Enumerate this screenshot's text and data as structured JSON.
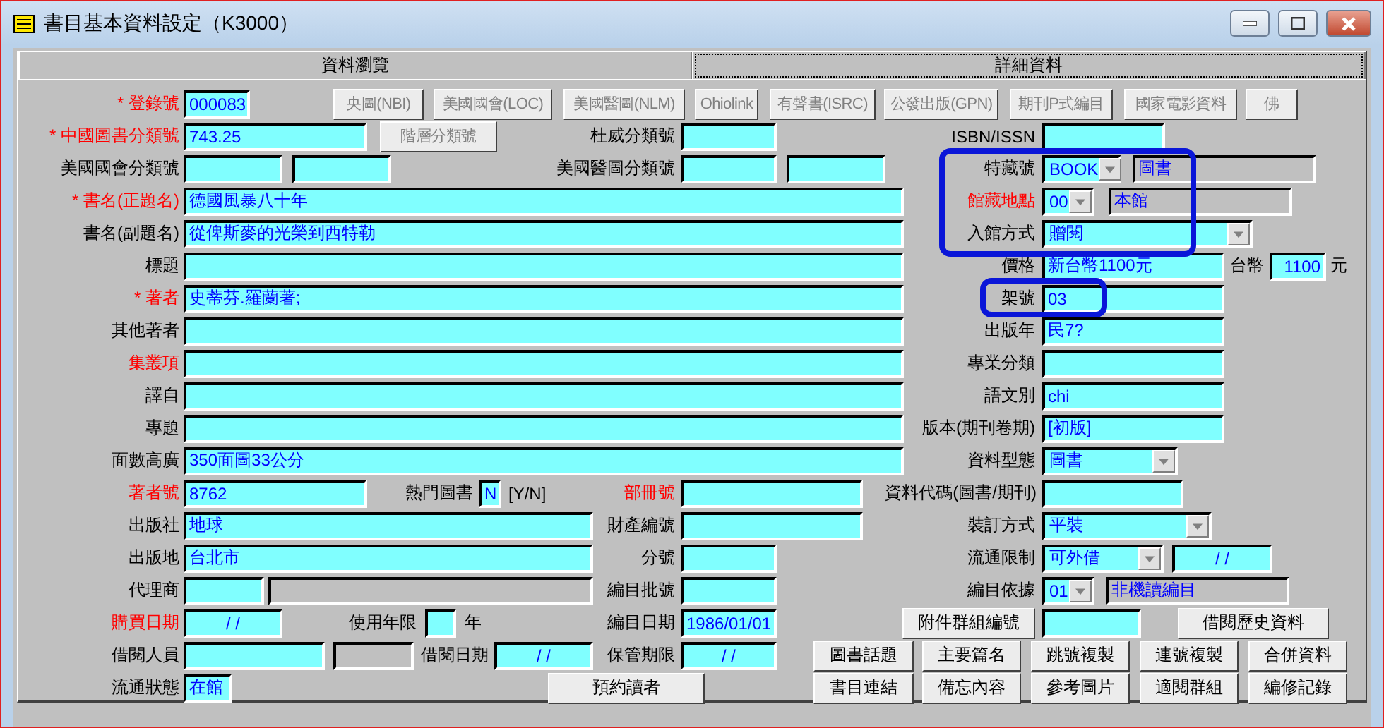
{
  "window": {
    "title": "書目基本資料設定（K3000）"
  },
  "tabs": [
    {
      "label": "資料瀏覽",
      "selected": false
    },
    {
      "label": "詳細資料",
      "selected": true
    }
  ],
  "rows": [
    {
      "items": [
        {
          "kind": "label",
          "text": "* 登錄號",
          "required": true
        },
        {
          "kind": "field",
          "value": "000083"
        },
        {
          "kind": "button",
          "text": "央圖(NBI)",
          "disabled": true
        },
        {
          "kind": "button",
          "text": "美國國會(LOC)",
          "disabled": true
        },
        {
          "kind": "button",
          "text": "美國醫圖(NLM)",
          "disabled": true
        },
        {
          "kind": "button",
          "text": "Ohiolink",
          "disabled": true
        },
        {
          "kind": "button",
          "text": "有聲書(ISRC)",
          "disabled": true
        },
        {
          "kind": "button",
          "text": "公發出版(GPN)",
          "disabled": true
        },
        {
          "kind": "button",
          "text": "期刊P式編目",
          "disabled": true
        },
        {
          "kind": "button",
          "text": "國家電影資料",
          "disabled": true
        },
        {
          "kind": "button",
          "text": "佛",
          "disabled": true
        }
      ]
    },
    {
      "items": [
        {
          "kind": "label",
          "text": "* 中國圖書分類號",
          "required": true
        },
        {
          "kind": "field",
          "value": "743.25"
        },
        {
          "kind": "button",
          "text": "階層分類號",
          "disabled": true
        },
        {
          "kind": "label",
          "text": "杜威分類號",
          "required": false
        },
        {
          "kind": "field"
        },
        {
          "kind": "label",
          "text": "ISBN/ISSN",
          "required": false
        },
        {
          "kind": "field"
        }
      ]
    },
    {
      "items": [
        {
          "kind": "label",
          "text": "美國國會分類號",
          "required": false
        },
        {
          "kind": "field"
        },
        {
          "kind": "field"
        },
        {
          "kind": "label",
          "text": "美國醫圖分類號",
          "required": false
        },
        {
          "kind": "field"
        },
        {
          "kind": "field"
        },
        {
          "kind": "label",
          "text": "特藏號",
          "required": false
        },
        {
          "kind": "select",
          "value": "BOOK"
        },
        {
          "kind": "readonly",
          "value": "圖書"
        }
      ]
    },
    {
      "items": [
        {
          "kind": "label",
          "text": "* 書名(正題名)",
          "required": true
        },
        {
          "kind": "field",
          "value": "德國風暴八十年"
        },
        {
          "kind": "label",
          "text": "館藏地點",
          "required": true
        },
        {
          "kind": "select",
          "value": "00"
        },
        {
          "kind": "readonly",
          "value": "本館"
        }
      ]
    },
    {
      "items": [
        {
          "kind": "label",
          "text": "書名(副題名)",
          "required": false
        },
        {
          "kind": "field",
          "value": "從俾斯麥的光榮到西特勒"
        },
        {
          "kind": "label",
          "text": "入館方式",
          "required": false
        },
        {
          "kind": "select",
          "value": "贈閱"
        }
      ]
    },
    {
      "items": [
        {
          "kind": "label",
          "text": "標題",
          "required": false
        },
        {
          "kind": "field"
        },
        {
          "kind": "label",
          "text": "價格",
          "required": false
        },
        {
          "kind": "field",
          "value": "新台幣1100元"
        },
        {
          "kind": "note",
          "text": "台幣"
        },
        {
          "kind": "number",
          "value": "1100"
        },
        {
          "kind": "note",
          "text": "元"
        }
      ]
    },
    {
      "items": [
        {
          "kind": "label",
          "text": "* 著者",
          "required": true
        },
        {
          "kind": "field",
          "value": "史蒂芬.羅蘭著;"
        },
        {
          "kind": "label",
          "text": "架號",
          "required": false
        },
        {
          "kind": "field",
          "value": "03"
        }
      ]
    },
    {
      "items": [
        {
          "kind": "label",
          "text": "其他著者",
          "required": false
        },
        {
          "kind": "field"
        },
        {
          "kind": "label",
          "text": "出版年",
          "required": false
        },
        {
          "kind": "field",
          "value": "民7?"
        }
      ]
    },
    {
      "items": [
        {
          "kind": "label",
          "text": "集叢項",
          "required": true
        },
        {
          "kind": "field"
        },
        {
          "kind": "label",
          "text": "專業分類",
          "required": false
        },
        {
          "kind": "field"
        }
      ]
    },
    {
      "items": [
        {
          "kind": "label",
          "text": "譯自",
          "required": false
        },
        {
          "kind": "field"
        },
        {
          "kind": "label",
          "text": "語文別",
          "required": false
        },
        {
          "kind": "field",
          "value": "chi"
        }
      ]
    },
    {
      "items": [
        {
          "kind": "label",
          "text": "專題",
          "required": false
        },
        {
          "kind": "field"
        },
        {
          "kind": "label",
          "text": "版本(期刊卷期)",
          "required": false
        },
        {
          "kind": "field",
          "value": "[初版]"
        }
      ]
    },
    {
      "items": [
        {
          "kind": "label",
          "text": "面數高廣",
          "required": false
        },
        {
          "kind": "field",
          "value": "350面圖33公分"
        },
        {
          "kind": "label",
          "text": "資料型態",
          "required": false
        },
        {
          "kind": "select",
          "value": "圖書"
        }
      ]
    },
    {
      "items": [
        {
          "kind": "label",
          "text": "著者號",
          "required": true
        },
        {
          "kind": "field",
          "value": "8762"
        },
        {
          "kind": "label",
          "text": "熱門圖書",
          "required": false
        },
        {
          "kind": "field",
          "value": "N"
        },
        {
          "kind": "note",
          "text": "[Y/N]"
        },
        {
          "kind": "label",
          "text": "部冊號",
          "required": true
        },
        {
          "kind": "field"
        },
        {
          "kind": "label",
          "text": "資料代碼(圖書/期刊)",
          "required": false
        },
        {
          "kind": "field"
        }
      ]
    },
    {
      "items": [
        {
          "kind": "label",
          "text": "出版社",
          "required": false
        },
        {
          "kind": "field",
          "value": "地球"
        },
        {
          "kind": "label",
          "text": "財產編號",
          "required": false
        },
        {
          "kind": "field"
        },
        {
          "kind": "label",
          "text": "裝訂方式",
          "required": false
        },
        {
          "kind": "select",
          "value": "平裝"
        }
      ]
    },
    {
      "items": [
        {
          "kind": "label",
          "text": "出版地",
          "required": false
        },
        {
          "kind": "field",
          "value": "台北市"
        },
        {
          "kind": "label",
          "text": "分號",
          "required": false
        },
        {
          "kind": "field"
        },
        {
          "kind": "label",
          "text": "流通限制",
          "required": false
        },
        {
          "kind": "select",
          "value": "可外借"
        },
        {
          "kind": "date",
          "value": "/  /"
        }
      ]
    },
    {
      "items": [
        {
          "kind": "label",
          "text": "代理商",
          "required": false
        },
        {
          "kind": "field"
        },
        {
          "kind": "readonly"
        },
        {
          "kind": "label",
          "text": "編目批號",
          "required": false
        },
        {
          "kind": "field"
        },
        {
          "kind": "label",
          "text": "編目依據",
          "required": false
        },
        {
          "kind": "select",
          "value": "01"
        },
        {
          "kind": "readonly",
          "value": "非機讀編目"
        }
      ]
    },
    {
      "items": [
        {
          "kind": "label",
          "text": "購買日期",
          "required": true
        },
        {
          "kind": "date",
          "value": "/  /"
        },
        {
          "kind": "label",
          "text": "使用年限",
          "required": false
        },
        {
          "kind": "field"
        },
        {
          "kind": "note",
          "text": "年"
        },
        {
          "kind": "label",
          "text": "編目日期",
          "required": false
        },
        {
          "kind": "field",
          "value": "1986/01/01"
        },
        {
          "kind": "button",
          "text": "附件群組編號",
          "disabled": false
        },
        {
          "kind": "field"
        },
        {
          "kind": "button",
          "text": "借閱歷史資料",
          "disabled": false
        }
      ]
    },
    {
      "items": [
        {
          "kind": "label",
          "text": "借閱人員",
          "required": false
        },
        {
          "kind": "field"
        },
        {
          "kind": "readonly"
        },
        {
          "kind": "label",
          "text": "借閱日期",
          "required": false
        },
        {
          "kind": "date",
          "value": "/  /"
        },
        {
          "kind": "label",
          "text": "保管期限",
          "required": false
        },
        {
          "kind": "date",
          "value": "/  /"
        },
        {
          "kind": "button",
          "text": "圖書話題",
          "disabled": false
        },
        {
          "kind": "button",
          "text": "主要篇名",
          "disabled": false
        },
        {
          "kind": "button",
          "text": "跳號複製",
          "disabled": false
        },
        {
          "kind": "button",
          "text": "連號複製",
          "disabled": false
        },
        {
          "kind": "button",
          "text": "合併資料",
          "disabled": false
        }
      ]
    },
    {
      "items": [
        {
          "kind": "label",
          "text": "流通狀態",
          "required": false
        },
        {
          "kind": "field",
          "value": "在館"
        },
        {
          "kind": "button",
          "text": "預約讀者",
          "disabled": false
        },
        {
          "kind": "button",
          "text": "書目連結",
          "disabled": false
        },
        {
          "kind": "button",
          "text": "備忘內容",
          "disabled": false
        },
        {
          "kind": "button",
          "text": "參考圖片",
          "disabled": false
        },
        {
          "kind": "button",
          "text": "適閱群組",
          "disabled": false
        },
        {
          "kind": "button",
          "text": "編修記錄",
          "disabled": false
        }
      ]
    }
  ]
}
